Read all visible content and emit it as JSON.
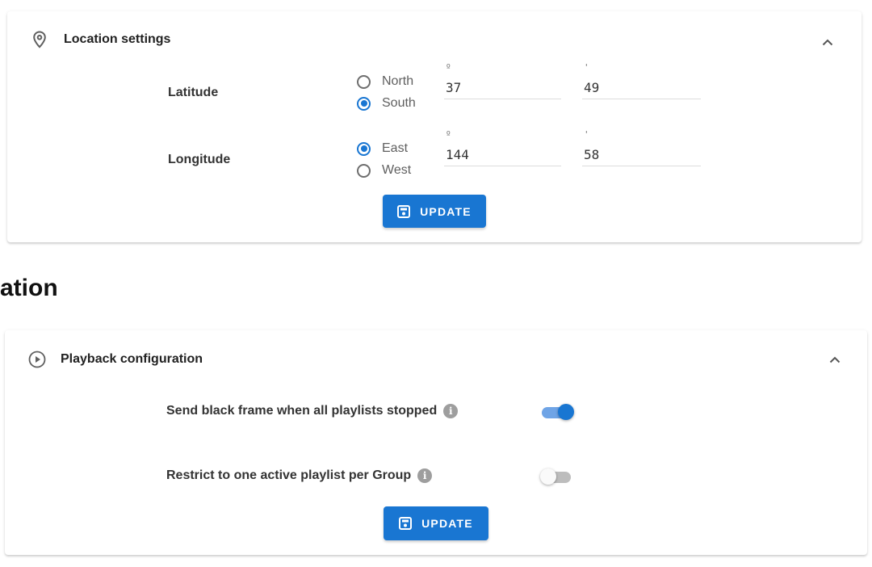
{
  "location_card": {
    "title": "Location settings",
    "icon": "location-pin-icon",
    "latitude": {
      "label": "Latitude",
      "options": [
        "North",
        "South"
      ],
      "selected": "South",
      "degrees_unit": "º",
      "degrees": "37",
      "minutes_unit": "'",
      "minutes": "49"
    },
    "longitude": {
      "label": "Longitude",
      "options": [
        "East",
        "West"
      ],
      "selected": "East",
      "degrees_unit": "º",
      "degrees": "144",
      "minutes_unit": "'",
      "minutes": "58"
    },
    "update_label": "UPDATE"
  },
  "section_title": "ation",
  "playback_card": {
    "title": "Playback configuration",
    "icon": "play-circle-icon",
    "settings": [
      {
        "label": "Send black frame when all playlists stopped",
        "enabled": true
      },
      {
        "label": "Restrict to one active playlist per Group",
        "enabled": false
      }
    ],
    "update_label": "UPDATE"
  },
  "colors": {
    "accent": "#1976d2",
    "toggle_track_on": "#6fa4e6",
    "toggle_track_off": "#bdbdbd",
    "info_badge": "#9e9e9e"
  }
}
